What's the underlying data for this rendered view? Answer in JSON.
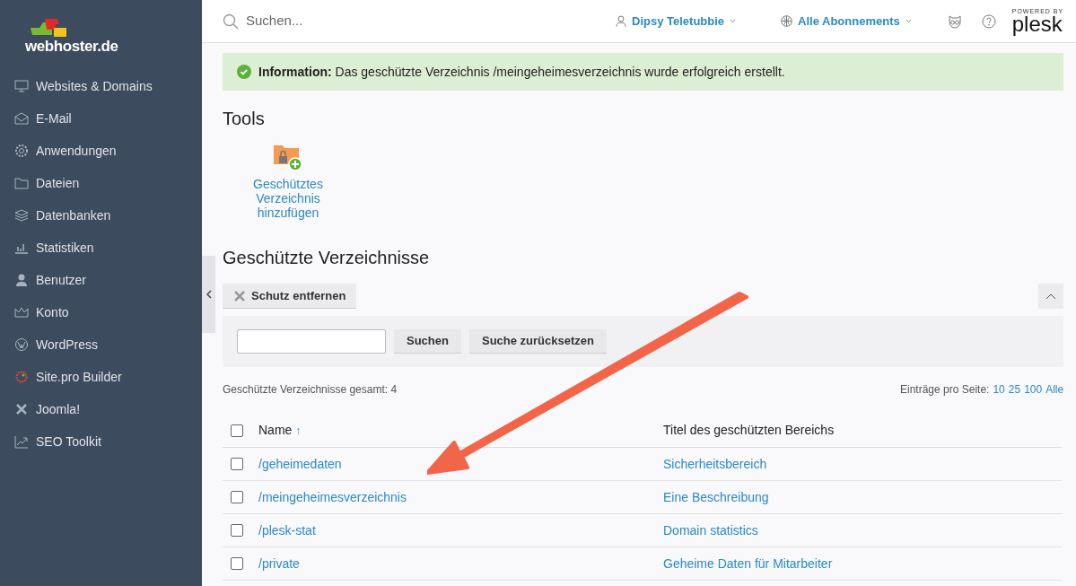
{
  "sidebar": {
    "logo": "webhoster.de",
    "items": [
      {
        "label": "Websites & Domains"
      },
      {
        "label": "E-Mail"
      },
      {
        "label": "Anwendungen"
      },
      {
        "label": "Dateien"
      },
      {
        "label": "Datenbanken"
      },
      {
        "label": "Statistiken"
      },
      {
        "label": "Benutzer"
      },
      {
        "label": "Konto"
      },
      {
        "label": "WordPress"
      },
      {
        "label": "Site.pro Builder"
      },
      {
        "label": "Joomla!"
      },
      {
        "label": "SEO Toolkit"
      }
    ]
  },
  "header": {
    "search": {
      "placeholder": "Suchen..."
    },
    "user": "Dipsy Teletubbie",
    "subscriptions": "Alle Abonnements",
    "powered_by": "POWERED BY",
    "brand": "plesk"
  },
  "message": {
    "label": "Information:",
    "text": "Das geschützte Verzeichnis /meingeheimesverzeichnis wurde erfolgreich erstellt."
  },
  "tools": {
    "title": "Tools",
    "items": [
      {
        "label": "Geschütztes Verzeichnis hinzufügen"
      }
    ]
  },
  "list": {
    "title": "Geschützte Verzeichnisse",
    "remove_button": "Schutz entfernen",
    "search_button": "Suchen",
    "reset_button": "Suche zurücksetzen",
    "total": "Geschützte Verzeichnisse gesamt: 4",
    "per_page_label": "Einträge pro Seite:",
    "per_page_options": [
      "10",
      "25",
      "100",
      "Alle"
    ],
    "select_all_checked": false,
    "columns": [
      {
        "label": "Name",
        "sort": "↑"
      },
      {
        "label": "Titel des geschützten Bereichs"
      }
    ],
    "rows": [
      {
        "name": "/geheimedaten",
        "title": "Sicherheitsbereich",
        "checked": false
      },
      {
        "name": "/meingeheimesverzeichnis",
        "title": "Eine Beschreibung",
        "checked": false
      },
      {
        "name": "/plesk-stat",
        "title": "Domain statistics",
        "checked": false
      },
      {
        "name": "/private",
        "title": "Geheime Daten für Mitarbeiter",
        "checked": false
      }
    ]
  }
}
